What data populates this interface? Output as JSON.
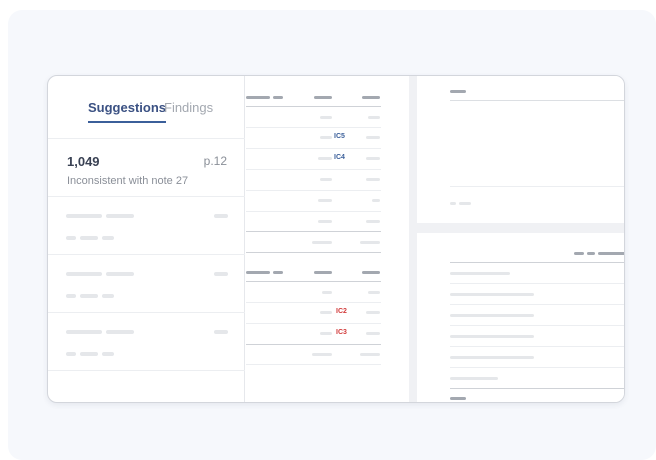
{
  "tabs": [
    {
      "label": "Suggestions",
      "active": true
    },
    {
      "label": "Findings",
      "active": false
    }
  ],
  "suggestion_card": {
    "number": "1,049",
    "page": "p.12",
    "description": "Inconsistent with note 27"
  },
  "inconsistency_markers": {
    "upper_table": [
      "IC5",
      "IC4"
    ],
    "lower_table": [
      "IC2",
      "IC3"
    ]
  },
  "colors": {
    "accent": "#3b5f9a",
    "marker_blue": "#3b5f9a",
    "marker_red": "#d23b3b"
  }
}
